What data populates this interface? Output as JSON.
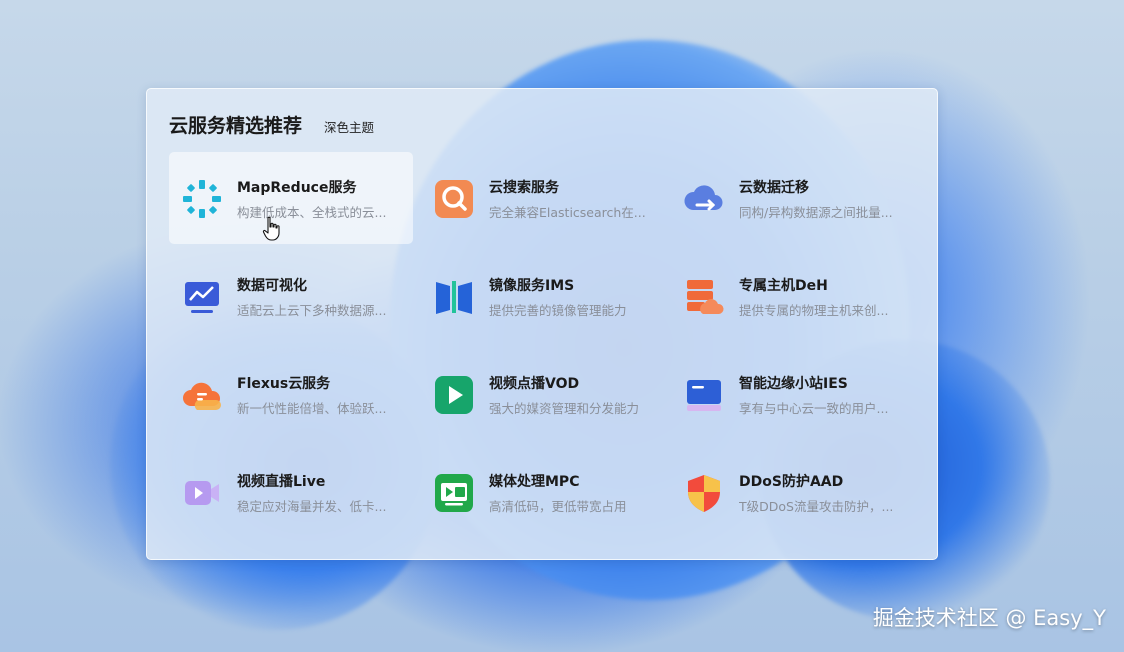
{
  "panel": {
    "title": "云服务精选推荐",
    "theme_toggle": "深色主题"
  },
  "services": [
    {
      "name": "MapReduce服务",
      "desc": "构建低成本、全栈式的云...",
      "icon": "mapreduce-icon",
      "hover": true
    },
    {
      "name": "云搜索服务",
      "desc": "完全兼容Elasticsearch在...",
      "icon": "search-icon"
    },
    {
      "name": "云数据迁移",
      "desc": "同构/异构数据源之间批量...",
      "icon": "cloud-migration-icon"
    },
    {
      "name": "数据可视化",
      "desc": "适配云上云下多种数据源...",
      "icon": "chart-monitor-icon"
    },
    {
      "name": "镜像服务IMS",
      "desc": "提供完善的镜像管理能力",
      "icon": "image-service-icon"
    },
    {
      "name": "专属主机DeH",
      "desc": "提供专属的物理主机来创...",
      "icon": "dedicated-host-icon"
    },
    {
      "name": "Flexus云服务",
      "desc": "新一代性能倍增、体验跃...",
      "icon": "flexus-cloud-icon"
    },
    {
      "name": "视频点播VOD",
      "desc": "强大的媒资管理和分发能力",
      "icon": "play-icon"
    },
    {
      "name": "智能边缘小站IES",
      "desc": "享有与中心云一致的用户...",
      "icon": "edge-station-icon"
    },
    {
      "name": "视频直播Live",
      "desc": "稳定应对海量并发、低卡...",
      "icon": "video-camera-icon"
    },
    {
      "name": "媒体处理MPC",
      "desc": "高清低码，更低带宽占用",
      "icon": "hd-media-icon"
    },
    {
      "name": "DDoS防护AAD",
      "desc": "T级DDoS流量攻击防护，...",
      "icon": "shield-icon"
    }
  ],
  "watermark": "掘金技术社区 @ Easy_Y",
  "colors": {
    "panel_bg": "#e0eaf6",
    "hover_bg": "#f4f7fb",
    "title": "#1a1a1a",
    "desc": "#8a8f99"
  }
}
